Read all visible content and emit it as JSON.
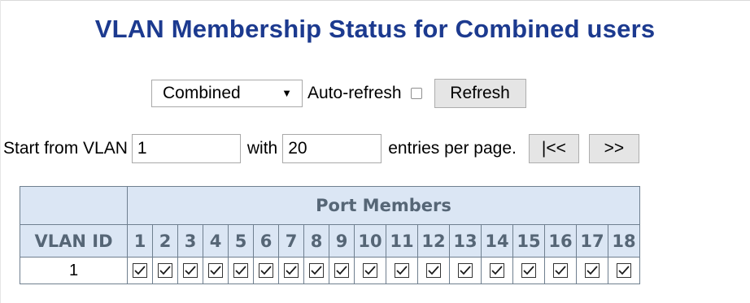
{
  "title": "VLAN Membership Status for Combined users",
  "controls": {
    "user_select": "Combined",
    "auto_refresh_label": "Auto-refresh",
    "auto_refresh_checked": false,
    "refresh_label": "Refresh"
  },
  "paging": {
    "start_label": "Start from VLAN",
    "start_value": "1",
    "with_label": "with",
    "entries_value": "20",
    "entries_label": "entries per page.",
    "first_label": "|<<",
    "next_label": ">>"
  },
  "table": {
    "group_header": "Port Members",
    "vlan_id_header": "VLAN ID",
    "ports": [
      "1",
      "2",
      "3",
      "4",
      "5",
      "6",
      "7",
      "8",
      "9",
      "10",
      "11",
      "12",
      "13",
      "14",
      "15",
      "16",
      "17",
      "18"
    ],
    "rows": [
      {
        "vlan_id": "1",
        "members": [
          true,
          true,
          true,
          true,
          true,
          true,
          true,
          true,
          true,
          true,
          true,
          true,
          true,
          true,
          true,
          true,
          true,
          true
        ]
      }
    ]
  }
}
